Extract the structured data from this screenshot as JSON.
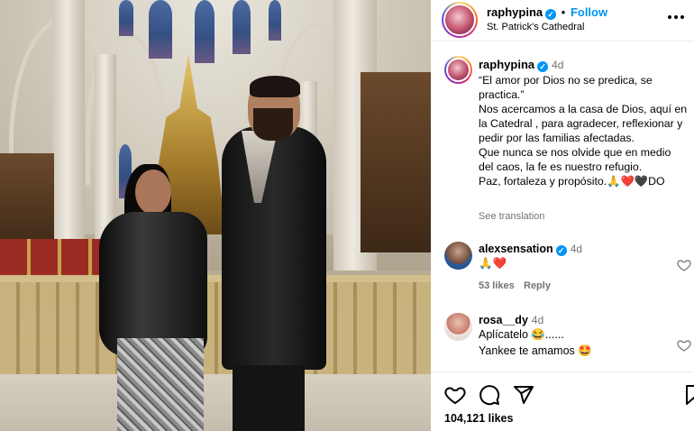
{
  "post": {
    "username": "raphypina",
    "verified_mark": "✓",
    "follow_label": "Follow",
    "separator": "•",
    "location": "St. Patrick's Cathedral",
    "more_icon": "more-horizontal-icon"
  },
  "caption": {
    "username": "raphypina",
    "time": "4d",
    "lines": [
      "“El amor por Dios no se predica, se practica.”",
      "Nos acercamos a la casa de Dios, aquí en la Catedral , para agradecer, reflexionar y pedir por las familias afectadas.",
      "Que nunca se nos olvide que en medio del caos, la fe es nuestro refugio.",
      "Paz, fortaleza y propósito.🙏❤️🖤DO"
    ],
    "see_translation": "See translation"
  },
  "comments": [
    {
      "username": "alexsensation",
      "verified": true,
      "time": "4d",
      "text": "🙏❤️",
      "likes": "53 likes",
      "reply": "Reply"
    },
    {
      "username": "rosa__dy",
      "verified": false,
      "time": "4d",
      "text": "Aplícatelo 😂......",
      "text2": "Yankee te amamos 🤩",
      "likes": "",
      "reply": ""
    }
  ],
  "actions": {
    "like_icon": "heart-icon",
    "comment_icon": "comment-icon",
    "share_icon": "share-icon",
    "save_icon": "bookmark-icon",
    "likes_count": "104,121 likes"
  },
  "colors": {
    "accent": "#0095f6",
    "muted": "#737373",
    "like_red": "#ed4956"
  }
}
